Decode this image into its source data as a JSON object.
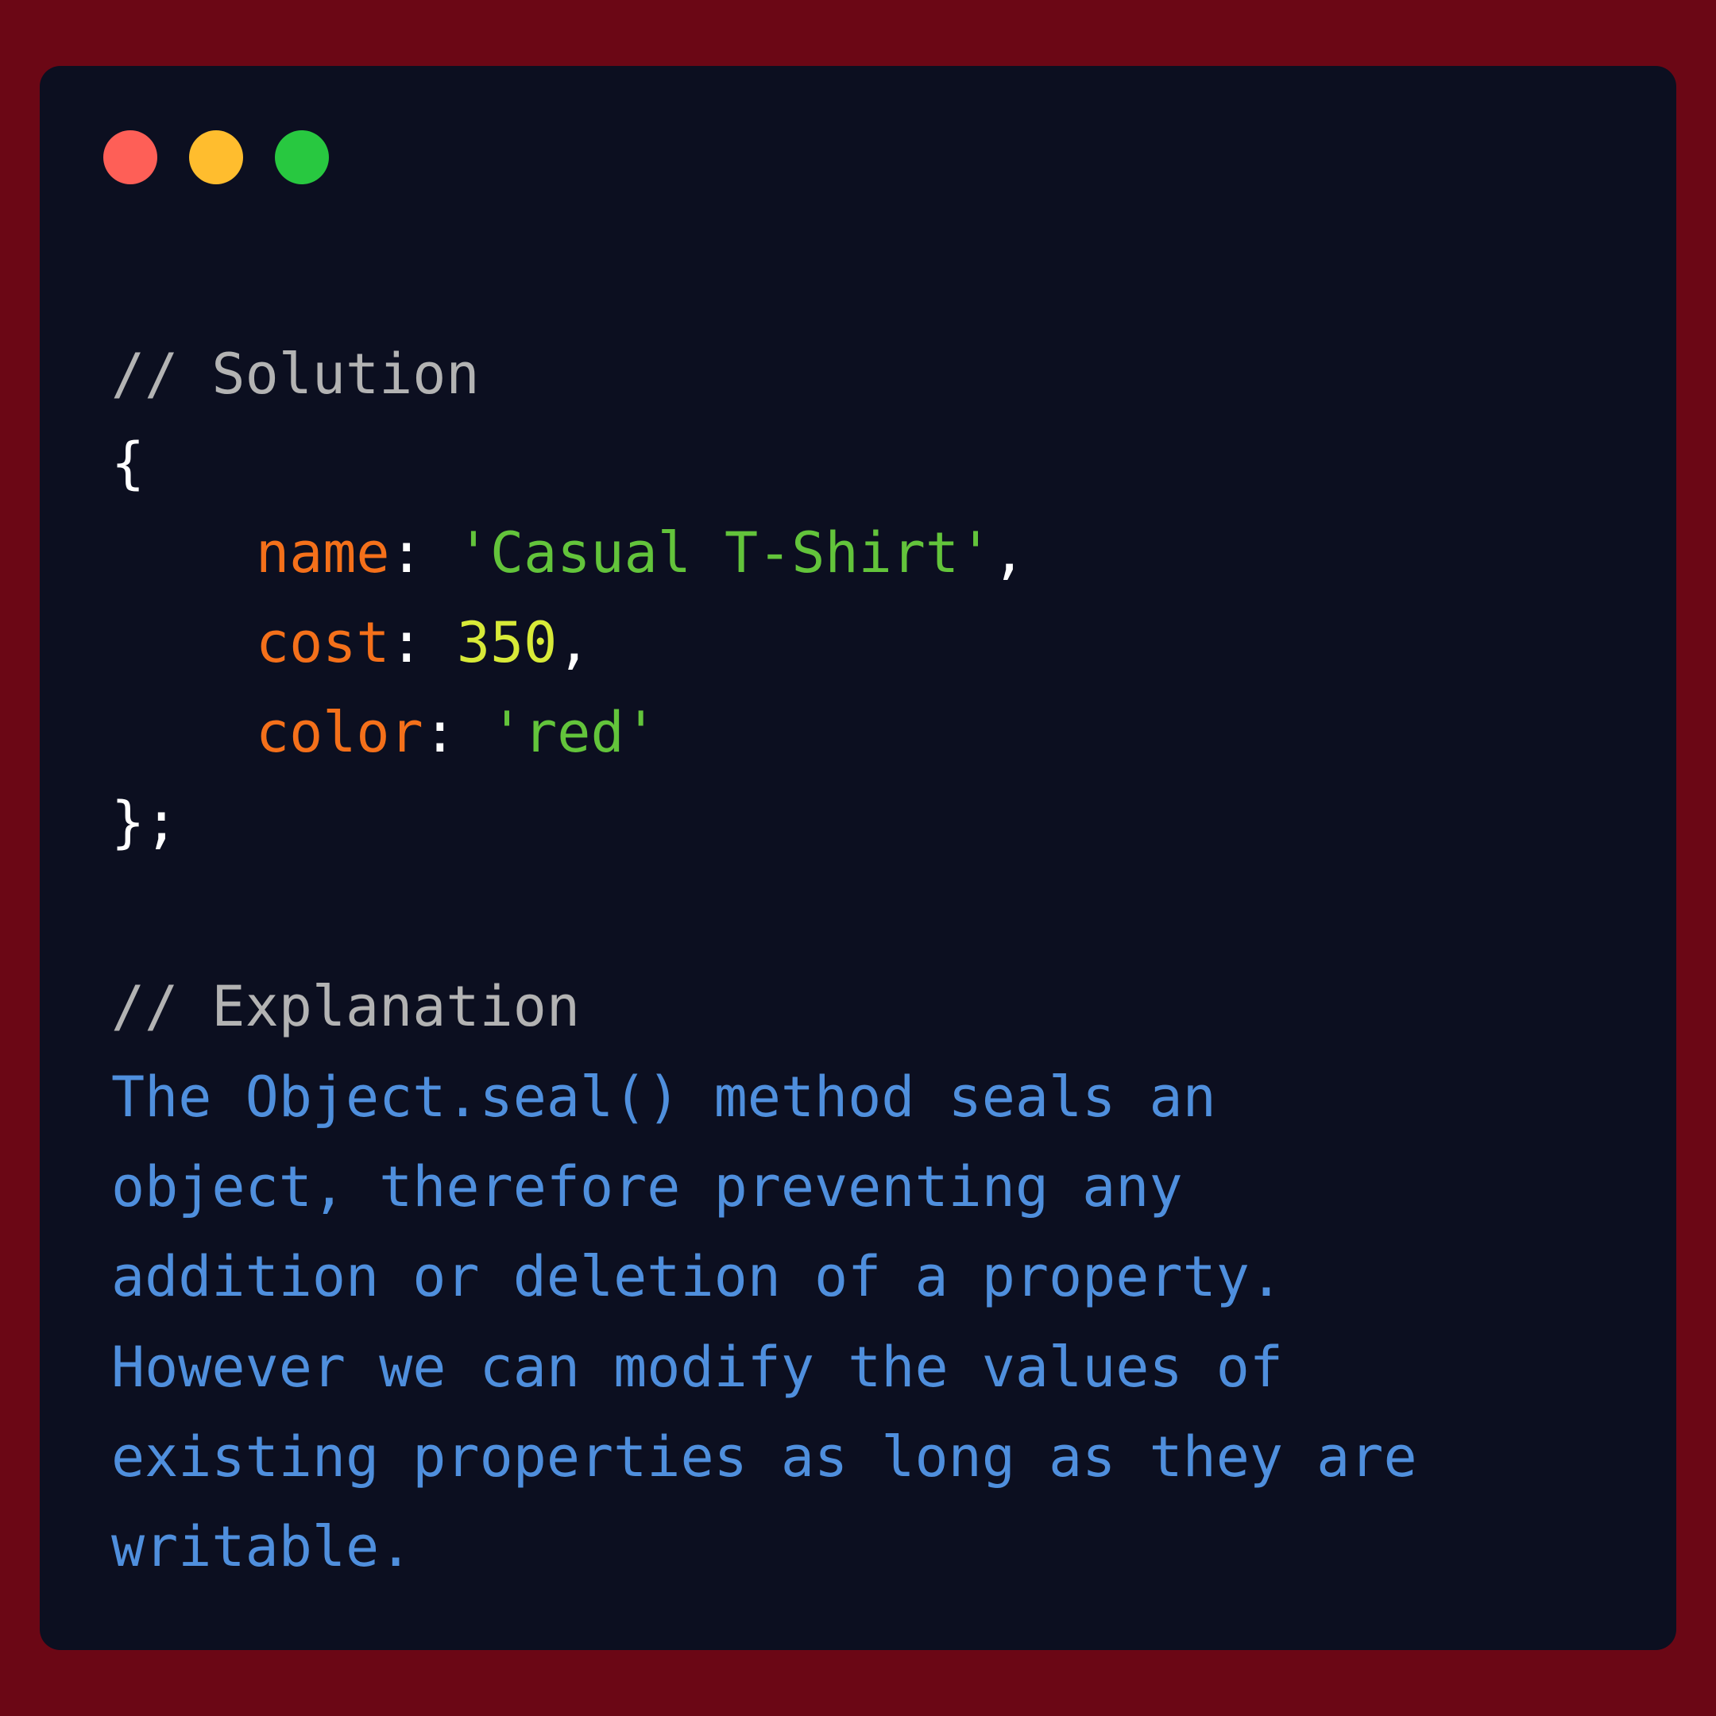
{
  "window": {
    "controls": {
      "close_color": "#fe5f57",
      "minimize_color": "#ffbd2e",
      "maximize_color": "#28c840"
    }
  },
  "code": {
    "solution_comment": "// Solution",
    "open_brace": "{",
    "props": [
      {
        "key": "name",
        "sep": ": ",
        "value": "'Casual T-Shirt'",
        "trail": ",",
        "value_type": "string"
      },
      {
        "key": "cost",
        "sep": ": ",
        "value": "350",
        "trail": ",",
        "value_type": "number"
      },
      {
        "key": "color",
        "sep": ": ",
        "value": "'red'",
        "trail": "",
        "value_type": "string"
      }
    ],
    "close_brace": "};",
    "explanation_comment": "// Explanation",
    "explanation_lines": [
      "The Object.seal() method seals an",
      "object, therefore preventing any",
      "addition or deletion of a property.",
      "However we can modify the values of",
      "existing properties as long as they are",
      "writable."
    ]
  },
  "colors": {
    "background": "#6b0715",
    "window": "#0c0f20",
    "comment": "#b3b3b3",
    "key": "#f4701a",
    "string": "#63c43b",
    "number": "#d8ea38",
    "explanation": "#4f8fdd"
  }
}
